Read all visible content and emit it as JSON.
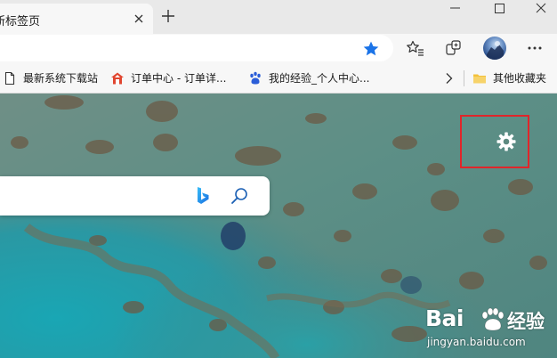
{
  "tab": {
    "title": "新标签页",
    "close_icon": "close-icon"
  },
  "tabstrip": {
    "new_tab_icon": "plus-icon"
  },
  "window_controls": [
    "minimize-icon",
    "maximize-icon",
    "close-icon"
  ],
  "toolbar": {
    "address_value": "",
    "favorite_star_color": "#1a73e8",
    "icons": [
      "star-icon",
      "favorites-icon",
      "collections-icon",
      "profile-avatar",
      "more-icon"
    ]
  },
  "favorites_bar": {
    "items": [
      {
        "label": "最新系统下载站",
        "icon": "page-icon"
      },
      {
        "label": "订单中心 - 订单详...",
        "icon": "house-logo-icon"
      },
      {
        "label": "我的经验_个人中心...",
        "icon": "paw-icon"
      }
    ],
    "overflow_icon": "chevron-right-icon",
    "other_folder": {
      "label": "其他收藏夹",
      "icon": "folder-icon"
    }
  },
  "new_tab_page": {
    "search": {
      "placeholder": "",
      "icons": [
        "bing-icon",
        "search-icon"
      ]
    },
    "settings_icon": "gear-icon",
    "highlight_color": "#e0252a"
  },
  "watermark": {
    "brand": "Bai",
    "brand_suffix": "经验",
    "url": "jingyan.baidu.com"
  }
}
